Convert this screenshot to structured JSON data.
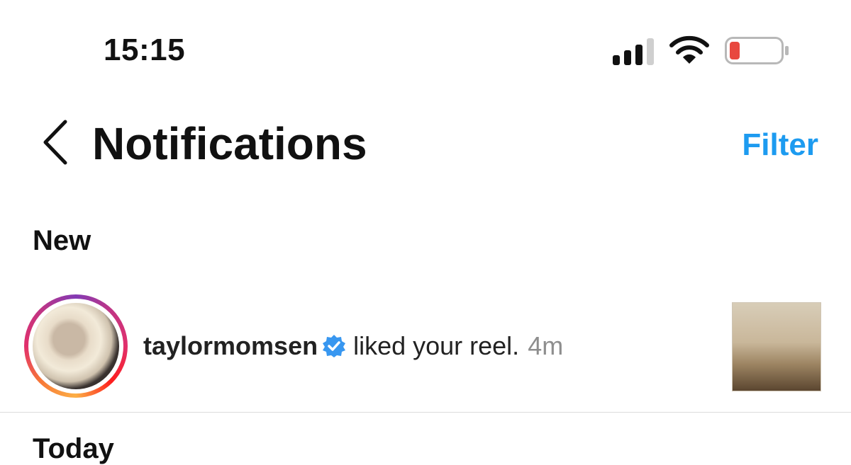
{
  "status_bar": {
    "time": "15:15",
    "battery_color": "#e8483f"
  },
  "header": {
    "title": "Notifications",
    "filter_label": "Filter",
    "accent_color": "#1d9bf0"
  },
  "sections": {
    "new_label": "New",
    "today_label": "Today"
  },
  "notification": {
    "username": "taylormomsen",
    "verified": true,
    "action": "liked your reel.",
    "time_ago": "4m"
  }
}
